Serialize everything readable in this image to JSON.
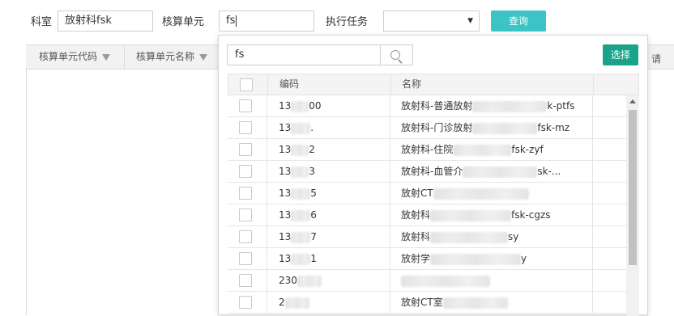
{
  "filters": {
    "dept_label": "科室",
    "dept_value": "放射科fsk",
    "unit_label": "核算单元",
    "unit_value": "fs",
    "task_label": "执行任务",
    "task_value": "",
    "query_label": "查询"
  },
  "grid": {
    "columns": [
      "核算单元代码",
      "核算单元名称"
    ],
    "edge_char": "请"
  },
  "dropdown": {
    "search_value": "fs",
    "select_label": "选择",
    "headers": {
      "code": "编码",
      "name": "名称"
    },
    "rows": [
      {
        "code_a": "13",
        "code_b": "00",
        "name_a": "放射科-普通放射",
        "name_b": "k-ptfs"
      },
      {
        "code_a": "13",
        "code_b": ".",
        "name_a": "放射科-门诊放射",
        "name_b": "fsk-mz"
      },
      {
        "code_a": "13",
        "code_b": "2",
        "name_a": "放射科-住院",
        "name_b": "fsk-zyf"
      },
      {
        "code_a": "13",
        "code_b": "3",
        "name_a": "放射科-血管介",
        "name_b": "sk-..."
      },
      {
        "code_a": "13",
        "code_b": "5",
        "name_a": "放射CT",
        "name_b": ""
      },
      {
        "code_a": "13",
        "code_b": "6",
        "name_a": "放射科",
        "name_b": "fsk-cgzs"
      },
      {
        "code_a": "13",
        "code_b": "7",
        "name_a": "放射科",
        "name_b": "sy"
      },
      {
        "code_a": "13",
        "code_b": "1",
        "name_a": "放射学",
        "name_b": "y"
      },
      {
        "code_a": "230",
        "code_b": "",
        "name_a": "",
        "name_b": ""
      },
      {
        "code_a": "2",
        "code_b": "",
        "name_a": "放射CT室",
        "name_b": ""
      }
    ]
  }
}
